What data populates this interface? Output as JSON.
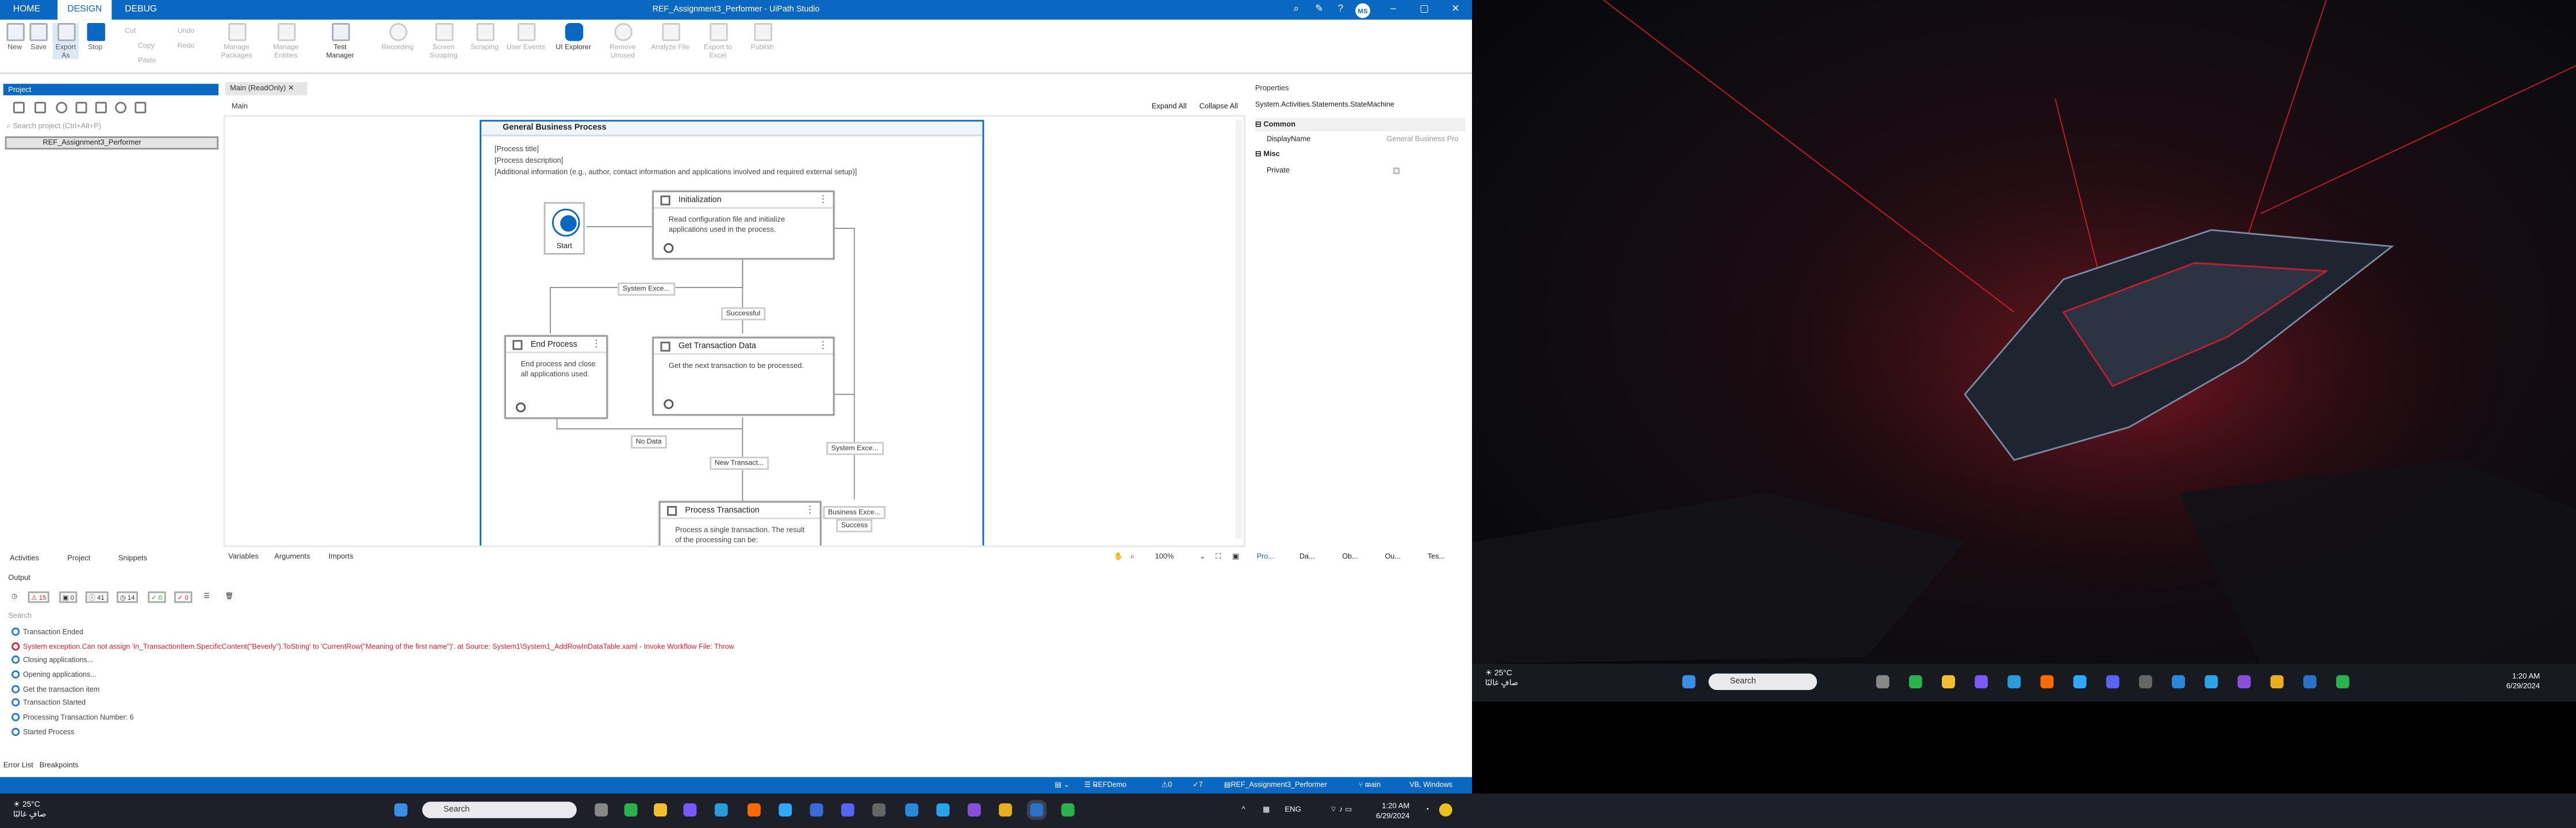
{
  "window": {
    "title": "REF_Assignment3_Performer - UiPath Studio",
    "tabs": [
      "HOME",
      "DESIGN",
      "DEBUG"
    ],
    "avatar": "MS"
  },
  "ribbon": {
    "new": "New",
    "save": "Save",
    "export_as": "Export As",
    "stop": "Stop",
    "cut": "Cut",
    "copy": "Copy",
    "paste": "Paste",
    "undo": "Undo",
    "redo": "Redo",
    "manage_packages": "Manage Packages",
    "manage_entities": "Manage Entities",
    "test_manager": "Test Manager",
    "recording": "Recording",
    "screen_scraping": "Screen Scraping",
    "scraping": "Scraping",
    "user_events": "User Events",
    "ui_explorer": "UI Explorer",
    "remove_unused": "Remove Unused",
    "analyze_file": "Analyze File",
    "export_to_excel": "Export to Excel",
    "publish": "Publish"
  },
  "project": {
    "header": "Project",
    "search_placeholder": "Search project (Ctrl+Alt+P)",
    "root_item": "REF_Assignment3_Performer",
    "bottom_tabs": [
      "Activities",
      "Project",
      "Snippets"
    ]
  },
  "designer": {
    "doc_tab": "Main (ReadOnly)",
    "breadcrumb": "Main",
    "expand_all": "Expand All",
    "collapse_all": "Collapse All",
    "container_title": "General Business Process",
    "desc_title": "[Process title]",
    "desc_description": "[Process description]",
    "desc_info": "[Additional information (e.g., author, contact information and applications involved and required external setup)]",
    "start_label": "Start",
    "states": {
      "init": {
        "title": "Initialization",
        "body": "Read configuration file and initialize applications used in the process."
      },
      "end": {
        "title": "End Process",
        "body": "End process and close all applications used."
      },
      "get": {
        "title": "Get Transaction Data",
        "body": "Get the next transaction to be processed."
      },
      "proc": {
        "title": "Process Transaction",
        "body": "Process a single transaction. The result of the processing can be:"
      }
    },
    "transitions": {
      "sys_exc_1": "System Exce...",
      "successful": "Successful",
      "no_data": "No Data",
      "new_trans": "New Transact...",
      "sys_exc_2": "System Exce...",
      "business_exc": "Business Exce...",
      "success": "Success"
    },
    "bottom_tabs": [
      "Variables",
      "Arguments",
      "Imports"
    ],
    "zoom": "100%"
  },
  "properties": {
    "header": "Properties",
    "type": "System.Activities.Statements.StateMachine",
    "cat_common": "Common",
    "display_name_label": "DisplayName",
    "display_name_value": "General Business Pro",
    "cat_misc": "Misc",
    "private_label": "Private",
    "bottom_tabs": [
      "Pro...",
      "Da...",
      "Ob...",
      "Ou...",
      "Tes..."
    ]
  },
  "output": {
    "header": "Output",
    "counts": [
      "15",
      "0",
      "41",
      "14",
      "0",
      "0"
    ],
    "search_placeholder": "Search",
    "lines": [
      {
        "text": "Transaction Ended",
        "error": false
      },
      {
        "text": "System exception.Can not assign 'in_TransactionItem.SpecificContent(\"Beverly\").ToString' to 'CurrentRow(\"Meaning of the first name\")'. at Source: System1\\System1_AddRowInDataTable.xaml - Invoke Workflow File: Throw",
        "error": true
      },
      {
        "text": "Closing applications...",
        "error": false
      },
      {
        "text": "Opening applications...",
        "error": false
      },
      {
        "text": "Get the transaction item",
        "error": false
      },
      {
        "text": "Transaction Started",
        "error": false
      },
      {
        "text": "Processing Transaction Number: 6",
        "error": false
      },
      {
        "text": "Started Process",
        "error": false
      }
    ],
    "footer_tabs": [
      "Error List",
      "Breakpoints"
    ]
  },
  "statusbar": {
    "repo": "REFDemo",
    "errors": "0",
    "warnings": "7",
    "project": "REF_Assignment3_Performer",
    "branch": "main",
    "platform": "VB, Windows"
  },
  "taskbar": {
    "weather_temp": "25°C",
    "weather_desc": "صافٍ غالبًا",
    "search": "Search",
    "lang": "ENG",
    "time": "1:20 AM",
    "date": "6/29/2024"
  },
  "colors": {
    "uipath_blue": "#0a67c2",
    "error_red": "#d22233"
  }
}
